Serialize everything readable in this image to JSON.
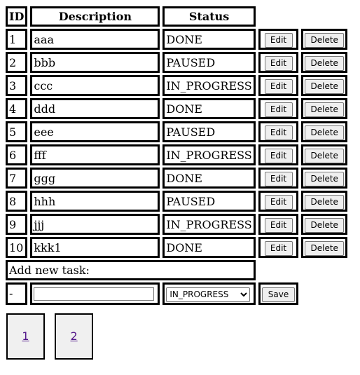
{
  "table": {
    "headers": {
      "id": "ID",
      "description": "Description",
      "status": "Status"
    },
    "rows": [
      {
        "id": "1",
        "description": "aaa",
        "status": "DONE"
      },
      {
        "id": "2",
        "description": "bbb",
        "status": "PAUSED"
      },
      {
        "id": "3",
        "description": "ccc",
        "status": "IN_PROGRESS"
      },
      {
        "id": "4",
        "description": "ddd",
        "status": "DONE"
      },
      {
        "id": "5",
        "description": "eee",
        "status": "PAUSED"
      },
      {
        "id": "6",
        "description": "fff",
        "status": "IN_PROGRESS"
      },
      {
        "id": "7",
        "description": "ggg",
        "status": "DONE"
      },
      {
        "id": "8",
        "description": "hhh",
        "status": "PAUSED"
      },
      {
        "id": "9",
        "description": "jjj",
        "status": "IN_PROGRESS"
      },
      {
        "id": "10",
        "description": "kkk1",
        "status": "DONE"
      }
    ],
    "edit_label": "Edit",
    "delete_label": "Delete"
  },
  "add_task": {
    "label": "Add new task:",
    "id_placeholder": "-",
    "description_value": "",
    "status_selected": "IN_PROGRESS",
    "status_options": [
      "IN_PROGRESS"
    ],
    "save_label": "Save"
  },
  "pagination": {
    "pages": [
      "1",
      "2"
    ]
  }
}
